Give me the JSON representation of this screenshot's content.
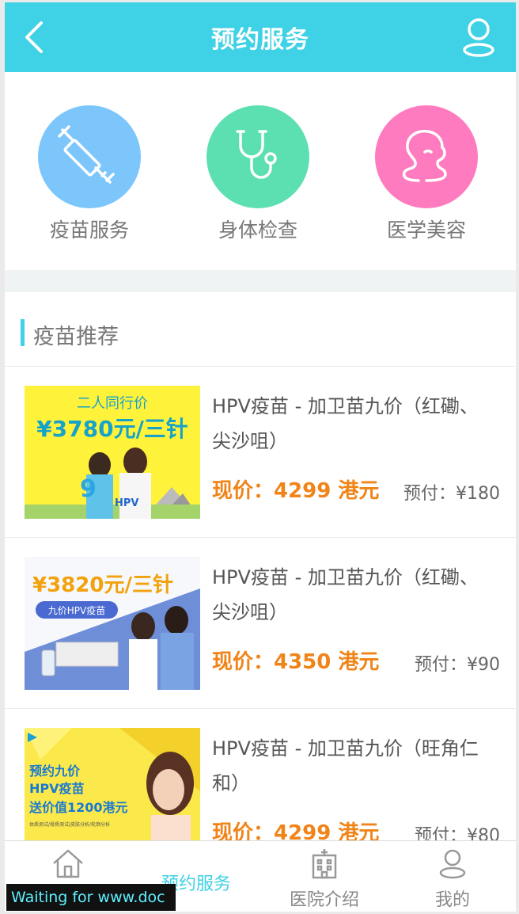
{
  "header": {
    "title": "预约服务"
  },
  "categories": [
    {
      "label": "疫苗服务",
      "icon": "syringe-icon",
      "color": "#7cc6fb"
    },
    {
      "label": "身体检查",
      "icon": "stethoscope-icon",
      "color": "#5ce0b1"
    },
    {
      "label": "医学美容",
      "icon": "face-profile-icon",
      "color": "#ff7bbf"
    }
  ],
  "section": {
    "title": "疫苗推荐"
  },
  "products": [
    {
      "name": "HPV疫苗 - 加卫苗九价（红磡、尖沙咀）",
      "price": "现价：4299 港元",
      "prepay": "预付：¥180",
      "banner": {
        "top": "二人同行价",
        "big": "¥3780元/三针",
        "tag": "HPV"
      }
    },
    {
      "name": "HPV疫苗 - 加卫苗九价（红磡、尖沙咀）",
      "price": "现价：4350 港元",
      "prepay": "预付：¥90",
      "banner": {
        "big": "¥3820元/三针",
        "tag": "九价HPV疫苗"
      }
    },
    {
      "name": "HPV疫苗 - 加卫苗九价（旺角仁和）",
      "price": "现价：4299 港元",
      "prepay": "预付：¥80",
      "banner": {
        "l1": "预约九价",
        "l2": "HPV疫苗",
        "l3": "送价值1200港元",
        "l4": "体质测试/骨质测试/皮肤分析/轮廓分析"
      }
    }
  ],
  "tabs": [
    {
      "label": "",
      "icon": "home-icon"
    },
    {
      "label": "预约服务",
      "icon": ""
    },
    {
      "label": "医院介绍",
      "icon": "hospital-icon"
    },
    {
      "label": "我的",
      "icon": "user-icon"
    }
  ],
  "status_text": "Waiting for www.doc",
  "colors": {
    "accent": "#3fd1e6",
    "price": "#f08418"
  }
}
